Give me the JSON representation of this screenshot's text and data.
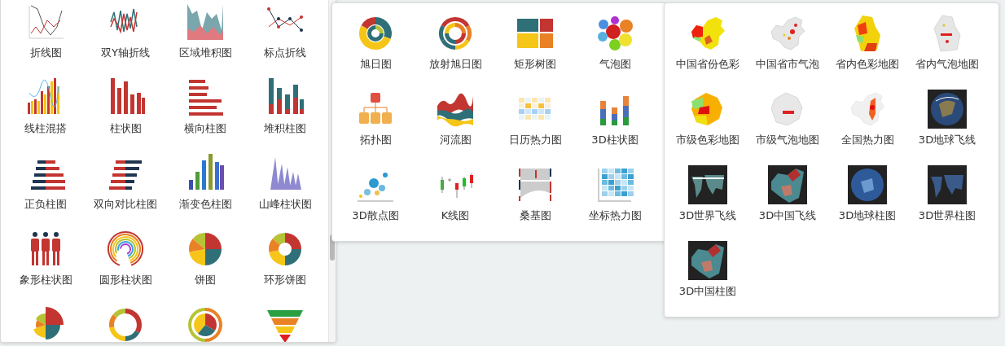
{
  "panels": [
    {
      "items": [
        {
          "kind": "labeled",
          "label": "折线图"
        },
        {
          "kind": "labeled",
          "label": "双Y轴折线"
        },
        {
          "kind": "labeled",
          "label": "区域堆积图"
        },
        {
          "kind": "labeled",
          "label": "标点折线"
        },
        {
          "kind": "labeled",
          "label": "线柱混搭"
        },
        {
          "kind": "labeled",
          "label": "柱状图"
        },
        {
          "kind": "labeled",
          "label": "横向柱图"
        },
        {
          "kind": "labeled",
          "label": "堆积柱图"
        },
        {
          "kind": "labeled",
          "label": "正负柱图"
        },
        {
          "kind": "labeled",
          "label": "双向对比柱图"
        },
        {
          "kind": "labeled",
          "label": "渐变色柱图"
        },
        {
          "kind": "labeled",
          "label": "山峰柱状图"
        },
        {
          "kind": "labeled",
          "label": "象形柱状图"
        },
        {
          "kind": "labeled",
          "label": "圆形柱状图"
        },
        {
          "kind": "labeled",
          "label": "饼图"
        },
        {
          "kind": "labeled",
          "label": "环形饼图"
        },
        {
          "kind": "icon_only"
        },
        {
          "kind": "icon_only"
        },
        {
          "kind": "icon_only"
        },
        {
          "kind": "icon_only"
        }
      ]
    },
    {
      "items": [
        {
          "kind": "labeled",
          "label": "旭日图"
        },
        {
          "kind": "labeled",
          "label": "放射旭日图"
        },
        {
          "kind": "labeled",
          "label": "矩形树图"
        },
        {
          "kind": "labeled",
          "label": "气泡图"
        },
        {
          "kind": "labeled",
          "label": "拓扑图"
        },
        {
          "kind": "labeled",
          "label": "河流图"
        },
        {
          "kind": "labeled",
          "label": "日历热力图"
        },
        {
          "kind": "labeled",
          "label": "3D柱状图"
        },
        {
          "kind": "labeled",
          "label": "3D散点图"
        },
        {
          "kind": "labeled",
          "label": "K线图"
        },
        {
          "kind": "labeled",
          "label": "桑基图"
        },
        {
          "kind": "labeled",
          "label": "坐标热力图"
        }
      ]
    },
    {
      "items": [
        {
          "kind": "labeled",
          "label": "中国省份色彩"
        },
        {
          "kind": "labeled",
          "label": "中国省市气泡"
        },
        {
          "kind": "labeled",
          "label": "省内色彩地图"
        },
        {
          "kind": "labeled",
          "label": "省内气泡地图"
        },
        {
          "kind": "labeled",
          "label": "市级色彩地图"
        },
        {
          "kind": "labeled",
          "label": "市级气泡地图"
        },
        {
          "kind": "labeled",
          "label": "全国热力图"
        },
        {
          "kind": "labeled",
          "label": "3D地球飞线"
        },
        {
          "kind": "labeled",
          "label": "3D世界飞线"
        },
        {
          "kind": "labeled",
          "label": "3D中国飞线"
        },
        {
          "kind": "labeled",
          "label": "3D地球柱图"
        },
        {
          "kind": "labeled",
          "label": "3D世界柱图"
        },
        {
          "kind": "labeled",
          "label": "3D中国柱图"
        }
      ]
    }
  ]
}
